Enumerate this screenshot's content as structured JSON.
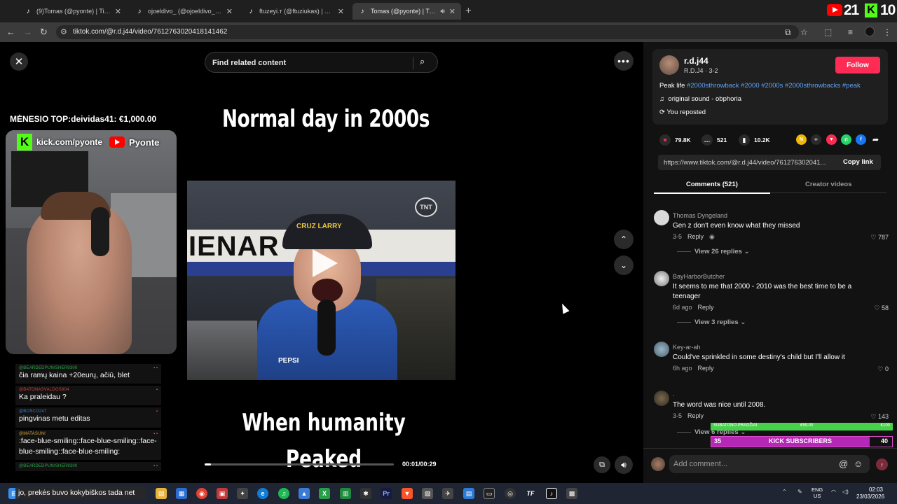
{
  "browser": {
    "tabs": [
      {
        "title": "(9)Tomas (@pyonte) | TikTok",
        "active": false
      },
      {
        "title": "ojoeldivo_ (@ojoeldivo_) | TikTo",
        "active": false
      },
      {
        "title": "ftuzeyi.т (@ftuziukas) | TikTok",
        "active": false
      },
      {
        "title": "Tomas (@pyonte) | TikTok",
        "active": true
      }
    ],
    "url": "tiktok.com/@r.d.j44/video/7612763020418141462",
    "overlay_counter": "21",
    "overlay_followers": "10"
  },
  "stream": {
    "top_donor": "MĖNESIO TOP:deividas41: €1,000.00",
    "kick_channel": "kick.com/pyonte",
    "youtube_channel": "Pyonte",
    "chat": [
      {
        "user": "@BEARDEDPUNISHER9300",
        "color": "green",
        "text": "čia ramų kaina +20eurų, ačiū, blet"
      },
      {
        "user": "@BATONASVALDOS804",
        "color": "red",
        "text": "Ka praleidau ?"
      },
      {
        "user": "@BOSCO247",
        "color": "blue",
        "text": "pingvinas metu editas"
      },
      {
        "user": "@MATASUNI",
        "color": "gold",
        "text": ":face-blue-smiling::face-blue-smiling::face-blue-smiling::face-blue-smiling:"
      },
      {
        "user": "@BEARDEDPUNISHER9300",
        "color": "green",
        "text": "jo, prekės buvo kokybiškos tada net"
      }
    ]
  },
  "video": {
    "search_placeholder": "Find related content",
    "caption_top": "Normal day in 2000s",
    "caption_bottom_1": "When humanity",
    "caption_bottom_2": "Peaked",
    "wall_text": "IENAR",
    "cap_text": "CRUZ LARRY",
    "channel_logo": "TNT",
    "jacket_logo": "PEPSI",
    "timecode": "00:01/00:29",
    "progress": 0.035
  },
  "panel": {
    "username": "r.d.j44",
    "subline": "R.D.J4 · 3-2",
    "follow_label": "Follow",
    "description_prefix": "Peak life ",
    "hashtags": "#2000sthrowback #2000 #2000s #2000sthrowbacks #peak",
    "sound": "original sound - obphoria",
    "reposted": "You reposted",
    "likes": "79.8K",
    "comments_count": "521",
    "saves": "10.2K",
    "link": "https://www.tiktok.com/@r.d.j44/video/761276302041...",
    "copy_link_label": "Copy link",
    "tab_comments": "Comments (521)",
    "tab_creator": "Creator videos",
    "comments": [
      {
        "name": "Thomas Dyngeland",
        "text": "Gen z don't even know what they missed",
        "date": "3-5",
        "likes": "787",
        "replies": "View 26 replies"
      },
      {
        "name": "BayHarborButcher",
        "text": "It seems to me that 2000 - 2010 was the best time to be a teenager",
        "date": "6d ago",
        "likes": "58",
        "replies": "View 3 replies"
      },
      {
        "name": "Key-ar-ah",
        "text": "Could've sprinkled in some destiny's child but I'll allow it",
        "date": "6h ago",
        "likes": "0",
        "replies": ""
      },
      {
        "name": ".",
        "text": "The word was nice until 2008.",
        "date": "3-5",
        "likes": "143",
        "replies": "View 6 replies"
      }
    ],
    "reply_label": "Reply",
    "add_comment_placeholder": "Add comment...",
    "sub_goal_left": "SUBATONO PRADŽIAI",
    "sub_goal_mid": "€59.00",
    "sub_goal_right": "€100",
    "kick_subs_current": "35",
    "kick_subs_label": "KICK SUBSCRIBERS",
    "kick_subs_goal": "40"
  },
  "taskbar": {
    "lang": "ENG",
    "region": "US",
    "time": "02:03",
    "date": "23/03/2026"
  },
  "colors": {
    "follow": "#fe2c55",
    "hashtag": "#5ea3f4",
    "kick_green": "#53fc18",
    "kick_purple": "#b528b5"
  }
}
